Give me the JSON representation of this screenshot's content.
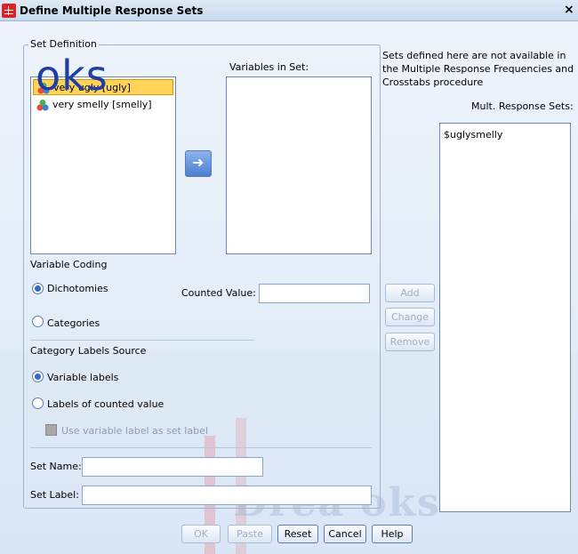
{
  "window": {
    "title": "Define Multiple Response Sets",
    "close_glyph": "×"
  },
  "overlay_text": "oks",
  "watermark_text": "Drea    oks",
  "set_definition": {
    "label": "Set Definition",
    "variables": [
      {
        "label": "very ugly [ugly]",
        "selected": true
      },
      {
        "label": "very smelly [smelly]",
        "selected": false
      }
    ],
    "variables_in_set_label": "Variables in Set:"
  },
  "variable_coding": {
    "label": "Variable Coding",
    "dichotomies": "Dichotomies",
    "categories": "Categories",
    "counted_value_label": "Counted Value:",
    "counted_value": ""
  },
  "category_labels_source": {
    "label": "Category Labels Source",
    "variable_labels": "Variable labels",
    "labels_of_counted_value": "Labels of counted value",
    "use_variable_label": "Use variable label as set label"
  },
  "set_name": {
    "label": "Set Name:",
    "value": ""
  },
  "set_label": {
    "label": "Set Label:",
    "value": ""
  },
  "right_panel": {
    "note": [
      "Sets defined here are not available in",
      "the Multiple Response Frequencies and",
      "Crosstabs procedure"
    ],
    "mult_response_sets_label": "Mult. Response Sets:",
    "sets": [
      "$uglysmelly"
    ]
  },
  "side_buttons": {
    "add": "Add",
    "change": "Change",
    "remove": "Remove"
  },
  "bottom_buttons": {
    "ok": "OK",
    "paste": "Paste",
    "reset": "Reset",
    "cancel": "Cancel",
    "help": "Help"
  }
}
